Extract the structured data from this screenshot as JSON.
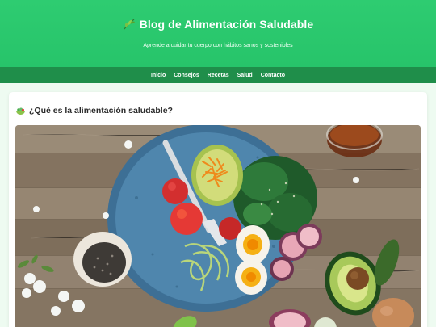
{
  "header": {
    "title": "Blog de Alimentación Saludable",
    "subtitle": "Aprende a cuidar tu cuerpo con hábitos sanos y sostenibles",
    "icon": "herb-leaf-icon",
    "brand_color": "#2ecc71"
  },
  "nav": {
    "items": [
      {
        "label": "Inicio"
      },
      {
        "label": "Consejos"
      },
      {
        "label": "Recetas"
      },
      {
        "label": "Salud"
      },
      {
        "label": "Contacto"
      }
    ],
    "background": "#1f8e4a"
  },
  "article": {
    "title": "¿Qué es la alimentación saludable?",
    "icon": "salad-bowl-icon"
  }
}
